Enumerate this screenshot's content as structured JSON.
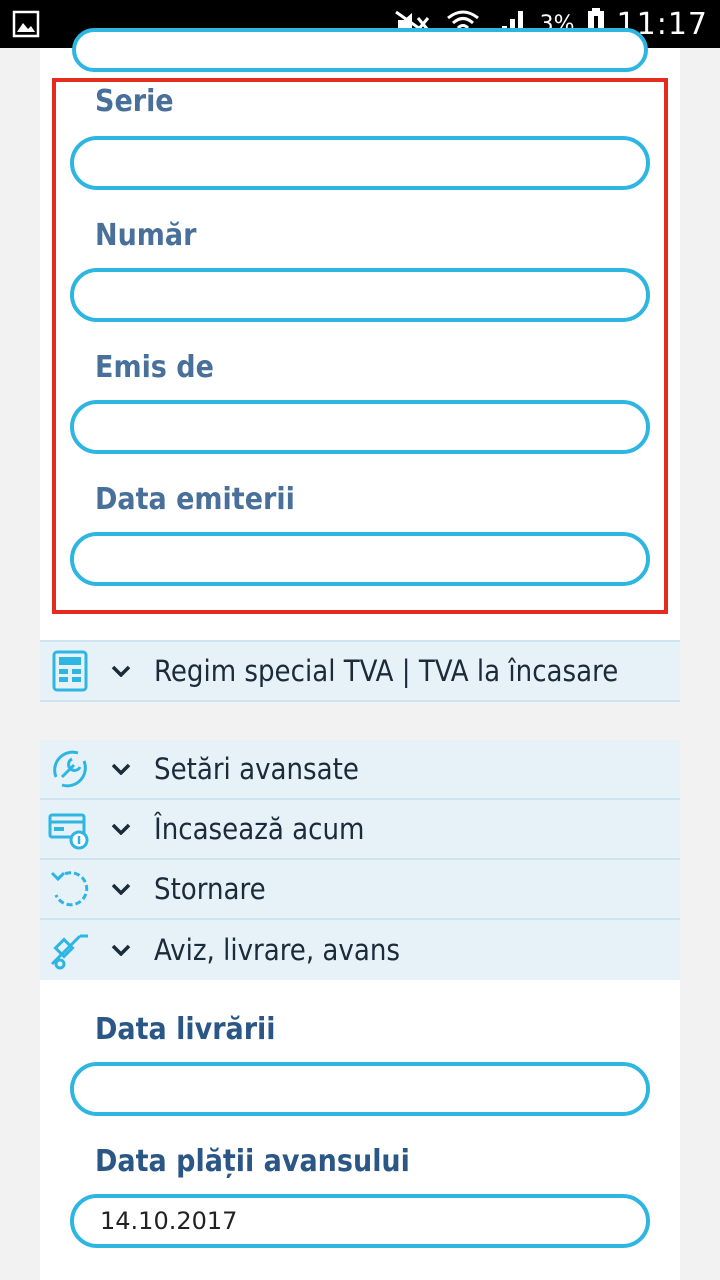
{
  "status_bar": {
    "battery_percent": "3%",
    "time": "11:17"
  },
  "form_fields": {
    "serie": {
      "label": "Serie",
      "value": ""
    },
    "numar": {
      "label": "Număr",
      "value": ""
    },
    "emis_de": {
      "label": "Emis de",
      "value": ""
    },
    "data_emiterii": {
      "label": "Data emiterii",
      "value": ""
    }
  },
  "sections": {
    "regim_special": {
      "label": "Regim special TVA | TVA la încasare",
      "icon": "calculator-icon"
    },
    "setari": {
      "label": "Setări avansate",
      "icon": "wrench-icon"
    },
    "incaseaza": {
      "label": "Încasează acum",
      "icon": "payment-icon"
    },
    "stornare": {
      "label": "Stornare",
      "icon": "reverse-icon"
    },
    "aviz": {
      "label": "Aviz, livrare, avans",
      "icon": "hand-truck-icon"
    }
  },
  "delivery_fields": {
    "data_livrarii": {
      "label": "Data livrării",
      "value": ""
    },
    "data_platii": {
      "label": "Data plății avansului",
      "value": "14.10.2017"
    }
  },
  "colors": {
    "accent": "#2db6e2",
    "label": "#48709a",
    "highlight": "#e42b1d",
    "section_bg": "#e6f1f8"
  }
}
